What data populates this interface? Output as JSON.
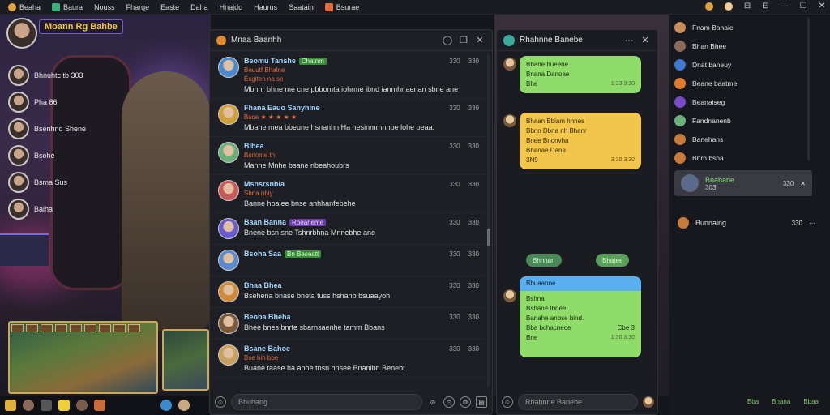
{
  "topbar": {
    "items": [
      {
        "label": "Beaha",
        "icon": "app-icon",
        "color": "#e8a23a"
      },
      {
        "label": "Baura",
        "icon": "stream-icon",
        "color": "#3ab07a"
      },
      {
        "label": "Nouss",
        "icon": "",
        "color": ""
      },
      {
        "label": "Fharge",
        "icon": "",
        "color": ""
      },
      {
        "label": "Easte",
        "icon": "",
        "color": ""
      },
      {
        "label": "Daha",
        "icon": "",
        "color": ""
      },
      {
        "label": "Hnajdo",
        "icon": "",
        "color": ""
      },
      {
        "label": "Haurus",
        "icon": "",
        "color": ""
      },
      {
        "label": "Saatain",
        "icon": "",
        "color": ""
      },
      {
        "label": "Bsurae",
        "icon": "folder-icon",
        "color": "#e06a3a"
      }
    ],
    "window_controls": [
      "⊟",
      "⊟",
      "—",
      "☐",
      "✕"
    ]
  },
  "stream": {
    "title": "Moann Rg Bahbe",
    "viewers": [
      {
        "name": "Bhnuhtc tb 303"
      },
      {
        "name": "Pha 86"
      },
      {
        "name": "Bsenhnd Shene"
      },
      {
        "name": "Bsohe"
      },
      {
        "name": "Bsma Sus"
      },
      {
        "name": "Baiha"
      }
    ]
  },
  "chat": {
    "title": "Mnaa Baanhh",
    "input_placeholder": "Bhuhang",
    "messages": [
      {
        "name": "Beomu Tanshe",
        "badge": "Chatnm",
        "sub": "Beuutf Bhalne",
        "sub2": "Esgiten na se",
        "text": "Mbnnr bhne me cne pbbomta iohrme ibnd ianmhr aenan sbne ane",
        "time": "330",
        "count": "330"
      },
      {
        "name": "Fhana Eauo Sanyhine",
        "badge": "",
        "sub": "Bsoe ★ ★ ★ ★ ★",
        "sub2": "",
        "text": "Mbane mea bbeune hsnanhn Ha hesinmrnnnbe lohe beaa.",
        "time": "330",
        "count": "330"
      },
      {
        "name": "Bihea",
        "badge": "",
        "sub": "Bsnome tn",
        "sub2": "",
        "text": "Manne Mnhe bsane nbeahoubrs",
        "time": "330",
        "count": "330"
      },
      {
        "name": "Msnsrsnbla",
        "badge": "",
        "sub": "Sbna nbiy",
        "sub2": "",
        "text": "Banne hbaiee bnse anhhanfebehe",
        "time": "330",
        "count": "330"
      },
      {
        "name": "Baan Banna",
        "badge": "Rboaneme",
        "sub": "",
        "sub2": "",
        "text": "Bnene bsn sne Tshnrbhna Mnnebhe ano",
        "time": "330",
        "count": "330"
      },
      {
        "name": "Bsoha Saa",
        "badge": "Bn Beseatt",
        "sub": "",
        "sub2": "",
        "text": "",
        "time": "330",
        "count": "330"
      },
      {
        "name": "Bhaa Bhea",
        "badge": "",
        "sub": "",
        "sub2": "",
        "text": "Bsehena bnase bneta tuss hsnanb bsuaayoh",
        "time": "330",
        "count": "330"
      },
      {
        "name": "Beoba Bheha",
        "badge": "",
        "sub": "",
        "sub2": "",
        "text": "Bhee bnes bnrte sbarnsaenhe tamm Bbans",
        "time": "330",
        "count": "330"
      },
      {
        "name": "Bsane Bahoe",
        "badge": "",
        "sub": "Bse hin bbe",
        "sub2": "",
        "text": "Buane taase ha abne tnsn hnsee Bnanibn Benebt",
        "time": "330",
        "count": "330"
      }
    ]
  },
  "dm": {
    "title": "Rhahnne Banebe",
    "bubbles": [
      {
        "lines": [
          "Bbane hueene",
          "Bnana Danoae",
          "Bhe"
        ],
        "time": "1:33 3:30"
      },
      {
        "lines": [
          "Bhaan Bbiam hnnes",
          "Bbnn Dbna nh Bhanr",
          "Bnee Bnonvha",
          "Bhanae Dane",
          "3N9"
        ],
        "time": "3:30 3:30"
      },
      {
        "lines": [
          "Bshna",
          "Bshane tbnee",
          "Banahe anbse bind.",
          "Bba bchacneoe",
          "Bne"
        ],
        "header": "Bbuaanne",
        "side": "Cbe 3",
        "time": "1:30 3:30"
      }
    ],
    "pill_left": "Bhnnan",
    "pill_right": "Bhatee"
  },
  "sidebar": {
    "contacts": [
      {
        "name": "Fnam Banaie",
        "color": "#c98a5a"
      },
      {
        "name": "Bhan Bhee",
        "color": "#8a6a5a"
      },
      {
        "name": "Dnat baheuy",
        "color": "#3a7ad0"
      },
      {
        "name": "Beane baatme",
        "color": "#e07a2a"
      },
      {
        "name": "Beanaiseg",
        "color": "#7a4ac8"
      },
      {
        "name": "Fandnanenb",
        "color": "#6ab07a"
      },
      {
        "name": "Banehans",
        "color": "#c87a3a"
      },
      {
        "name": "Bnrn bsna",
        "color": "#c87a3a"
      }
    ],
    "selected": {
      "name": "Bnabane",
      "sub": "303",
      "time": "330"
    },
    "bottom_item": {
      "name": "Bunnaing",
      "time": "330"
    },
    "footer": [
      "Bba",
      "Bnana",
      "Bbaa"
    ]
  }
}
